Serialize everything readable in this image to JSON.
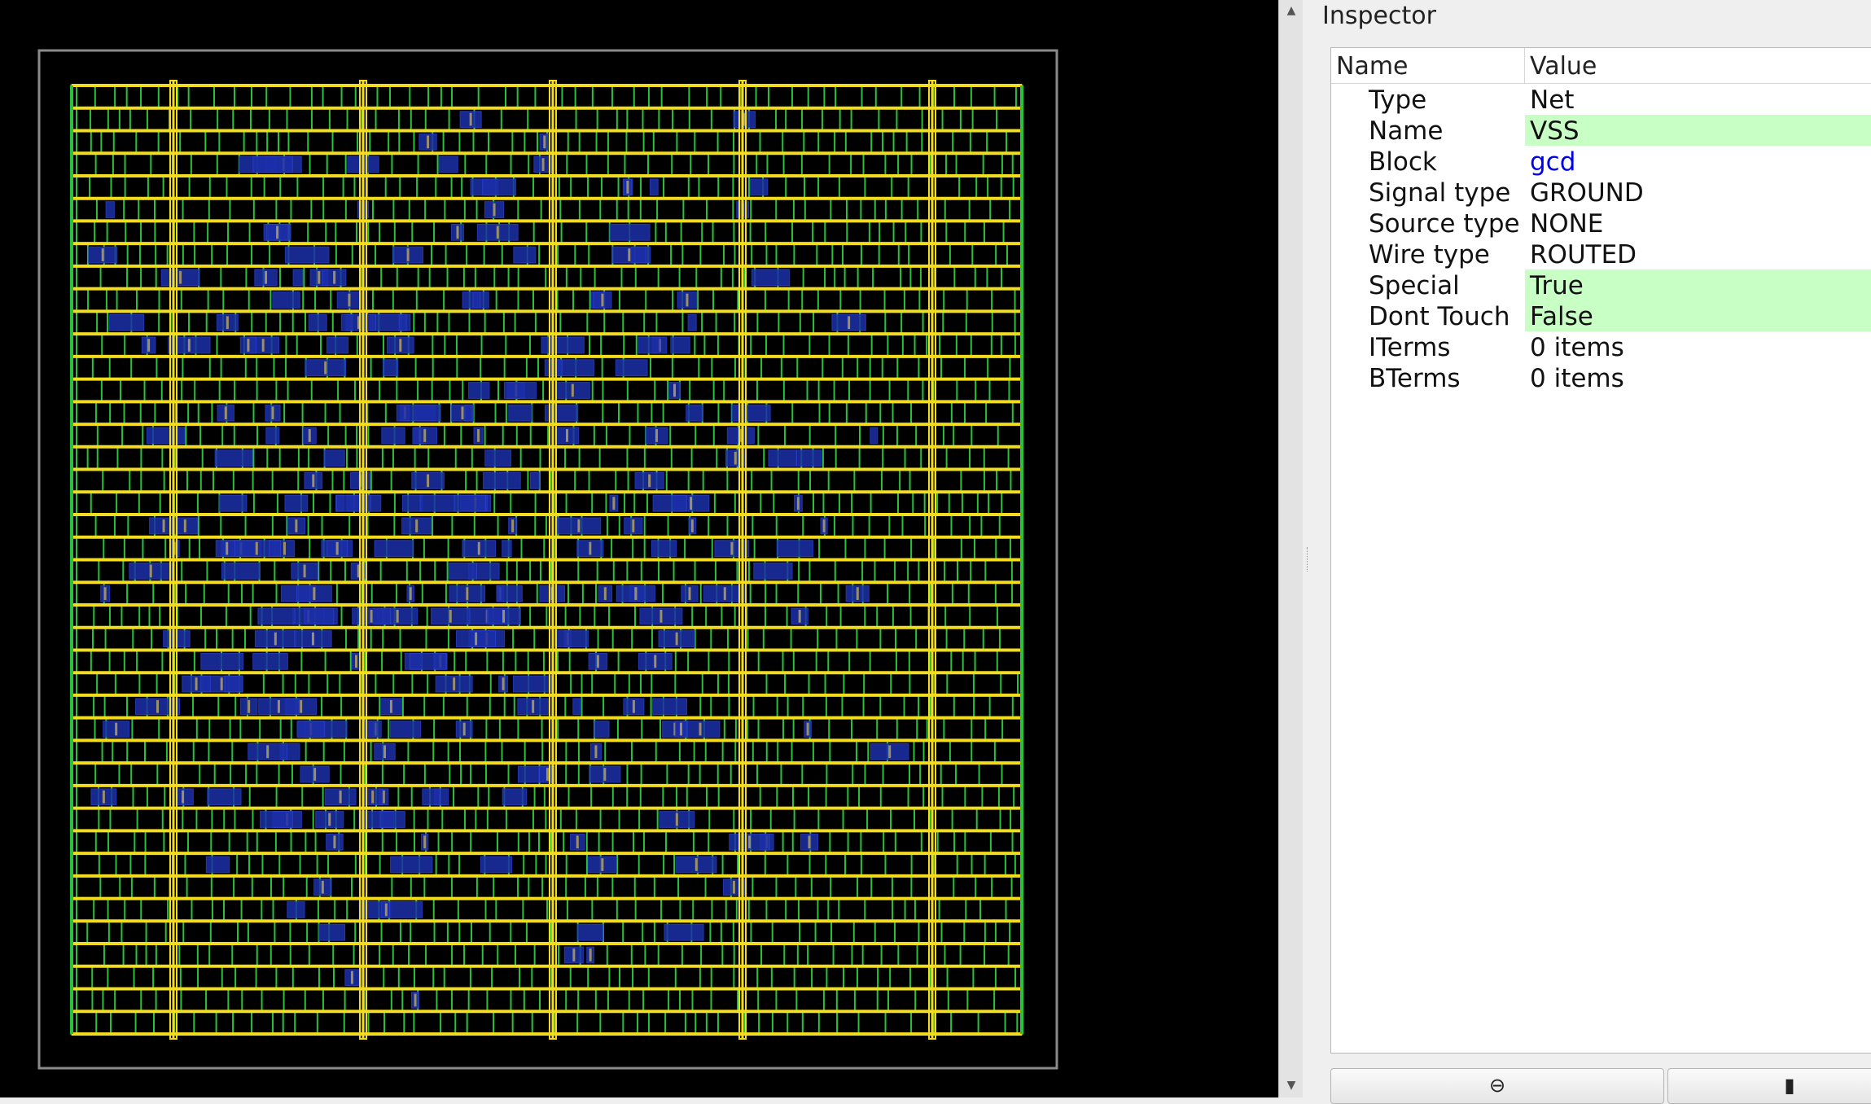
{
  "canvas": {
    "colors": {
      "background": "#000000",
      "die_outline": "#8a8a8a",
      "power_stripe": "#f2dc1d",
      "core_rows": "#29c23a",
      "cells": "#1c2fa8",
      "metal_small": "#9a8f6a"
    },
    "stripe_counts": {
      "horizontal_rails": 43,
      "vertical_straps": 5
    }
  },
  "scrollbar": {
    "up_icon": "triangle-up",
    "down_icon": "triangle-down"
  },
  "inspector": {
    "title": "Inspector",
    "columns": {
      "name": "Name",
      "value": "Value"
    },
    "properties": [
      {
        "name": "Type",
        "value": "Net",
        "highlight": false,
        "link": false
      },
      {
        "name": "Name",
        "value": "VSS",
        "highlight": true,
        "link": false
      },
      {
        "name": "Block",
        "value": "gcd",
        "highlight": false,
        "link": true
      },
      {
        "name": "Signal type",
        "value": "GROUND",
        "highlight": false,
        "link": false
      },
      {
        "name": "Source type",
        "value": "NONE",
        "highlight": false,
        "link": false
      },
      {
        "name": "Wire type",
        "value": "ROUTED",
        "highlight": false,
        "link": false
      },
      {
        "name": "Special",
        "value": "True",
        "highlight": true,
        "link": false
      },
      {
        "name": "Dont Touch",
        "value": "False",
        "highlight": true,
        "link": false
      },
      {
        "name": "ITerms",
        "value": "0 items",
        "highlight": false,
        "link": false
      },
      {
        "name": "BTerms",
        "value": "0 items",
        "highlight": false,
        "link": false
      }
    ],
    "buttons": {
      "zoom_icon": "zoom-out-icon",
      "highlight_icon": "highlight-icon"
    }
  }
}
